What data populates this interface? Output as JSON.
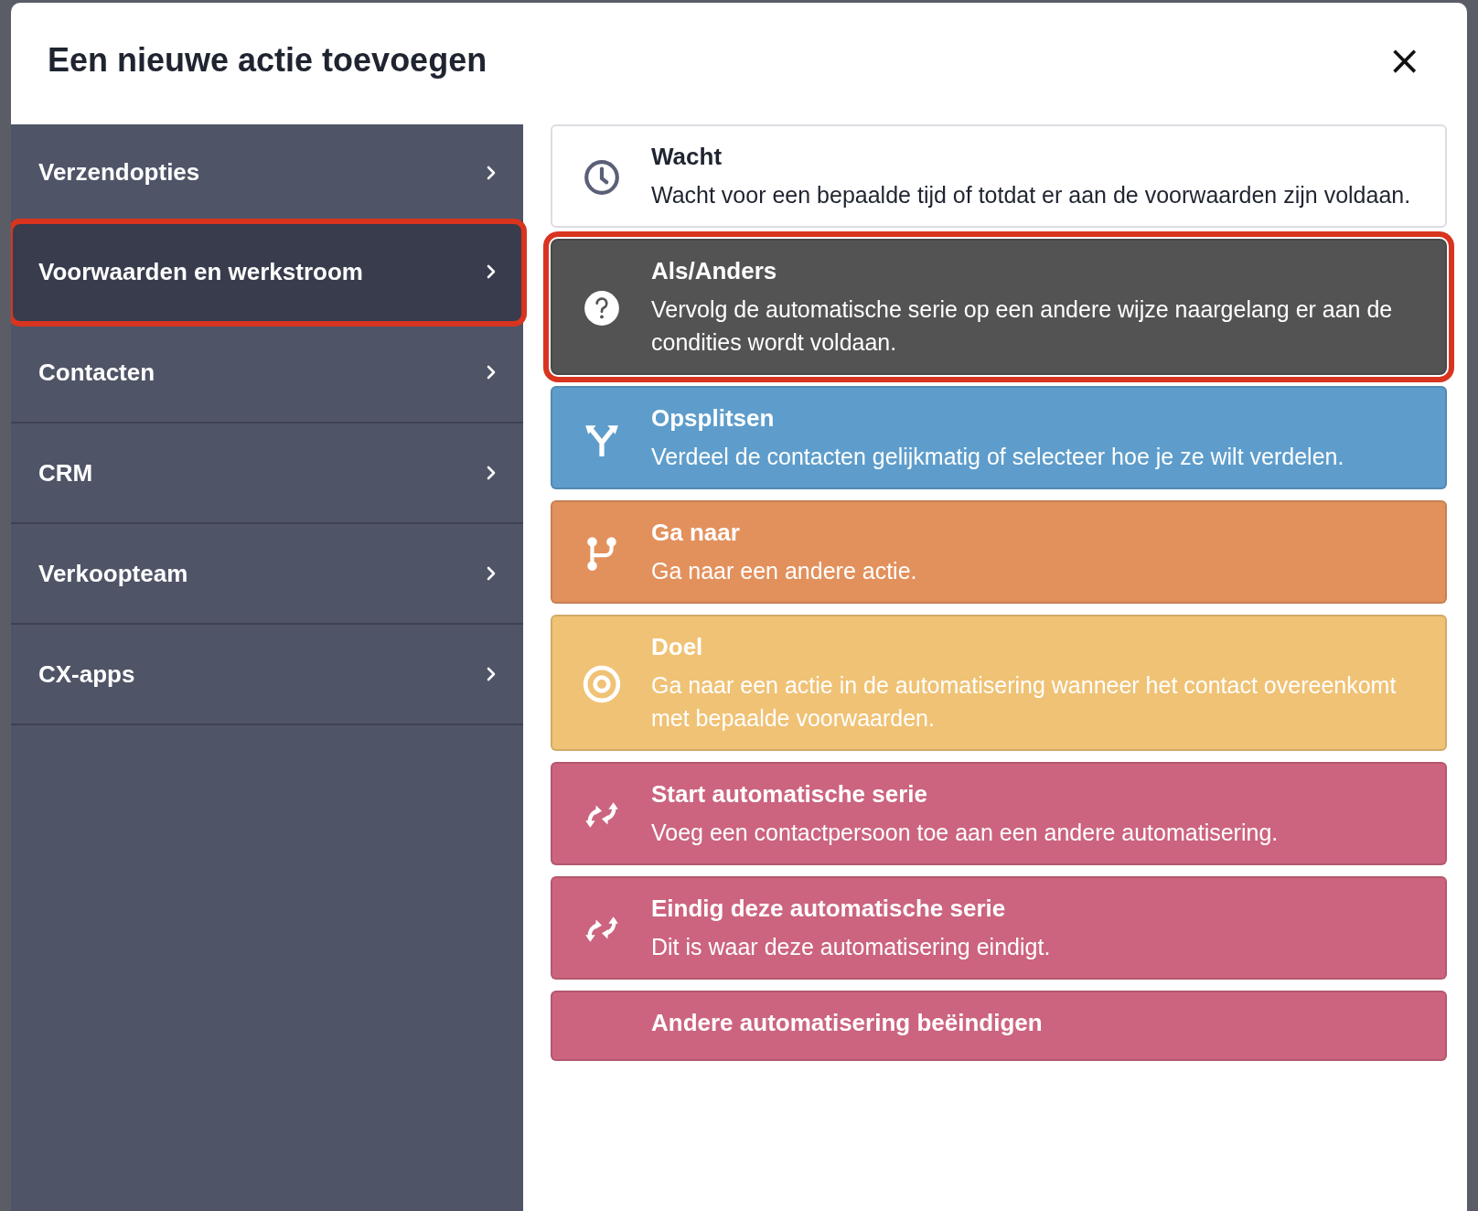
{
  "dialog": {
    "title": "Een nieuwe actie toevoegen",
    "close": "×"
  },
  "sidebar": {
    "items": [
      {
        "label": "Verzendopties",
        "selected": false,
        "highlighted": false
      },
      {
        "label": "Voorwaarden en werkstroom",
        "selected": true,
        "highlighted": true
      },
      {
        "label": "Contacten",
        "selected": false,
        "highlighted": false
      },
      {
        "label": "CRM",
        "selected": false,
        "highlighted": false
      },
      {
        "label": "Verkoopteam",
        "selected": false,
        "highlighted": false
      },
      {
        "label": "CX-apps",
        "selected": false,
        "highlighted": false
      }
    ]
  },
  "actions": [
    {
      "kind": "clock",
      "title": "Wacht",
      "description": "Wacht voor een bepaalde tijd of totdat er aan de voorwaarden zijn voldaan.",
      "color": "#ffffff",
      "highlighted": false
    },
    {
      "kind": "question",
      "title": "Als/Anders",
      "description": "Vervolg de automatische serie op een andere wijze naargelang er aan de condities wordt voldaan.",
      "color": "#535353",
      "highlighted": true
    },
    {
      "kind": "split",
      "title": "Opsplitsen",
      "description": "Verdeel de contacten gelijkmatig of selecteer hoe je ze wilt verdelen.",
      "color": "#5e9dcb",
      "highlighted": false
    },
    {
      "kind": "branch",
      "title": "Ga naar",
      "description": "Ga naar een andere actie.",
      "color": "#e2915d",
      "highlighted": false
    },
    {
      "kind": "target",
      "title": "Doel",
      "description": "Ga naar een actie in de automatisering wanneer het contact overeenkomt met bepaalde voorwaarden.",
      "color": "#f0c275",
      "highlighted": false
    },
    {
      "kind": "sync",
      "title": "Start automatische serie",
      "description": "Voeg een contactpersoon toe aan een andere automatisering.",
      "color": "#cc647f",
      "highlighted": false
    },
    {
      "kind": "sync",
      "title": "Eindig deze automatische serie",
      "description": "Dit is waar deze automatisering eindigt.",
      "color": "#cc647f",
      "highlighted": false
    },
    {
      "kind": "none",
      "title": "Andere automatisering beëindigen",
      "color": "#cc647f",
      "highlighted": false
    }
  ]
}
